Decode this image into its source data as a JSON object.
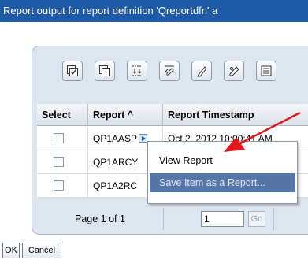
{
  "window": {
    "title": "Report output for report definition 'Qreportdfn' a"
  },
  "toolbar": {
    "buttons": [
      "select-all-icon",
      "deselect-all-icon",
      "expand-icon",
      "filter-icon",
      "edit-sort-icon",
      "clear-filter-icon",
      "more-actions-icon"
    ]
  },
  "table": {
    "columns": [
      {
        "label": "Select"
      },
      {
        "label": "Report ^"
      },
      {
        "label": "Report Timestamp"
      }
    ],
    "rows": [
      {
        "report": "QP1AASP",
        "timestamp": "Oct 2, 2012 10:00:41 AM"
      },
      {
        "report": "QP1ARCY",
        "timestamp": ""
      },
      {
        "report": "QP1A2RC",
        "timestamp": ""
      }
    ]
  },
  "pager": {
    "label": "Page 1 of 1",
    "page_value": "1",
    "go_label": "Go"
  },
  "buttons": {
    "ok": "OK",
    "cancel": "Cancel"
  },
  "context_menu": {
    "items": [
      {
        "label": "View Report"
      },
      {
        "label": "Save Item as a Report..."
      }
    ]
  },
  "colors": {
    "title_bar": "#1e5aa8",
    "menu_highlight": "#5576a6",
    "arrow": "#e0191b",
    "panel": "#dde5ef"
  }
}
